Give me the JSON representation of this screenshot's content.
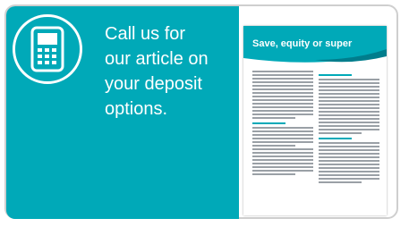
{
  "cta": {
    "lines": [
      "Call us for",
      "our article on",
      "your deposit",
      "options."
    ]
  },
  "document": {
    "title": "Save, equity or super"
  },
  "colors": {
    "teal": "#00a9b8",
    "dark_teal": "#007d8c",
    "white": "#ffffff"
  },
  "icons": {
    "phone": "mobile-phone-icon"
  }
}
